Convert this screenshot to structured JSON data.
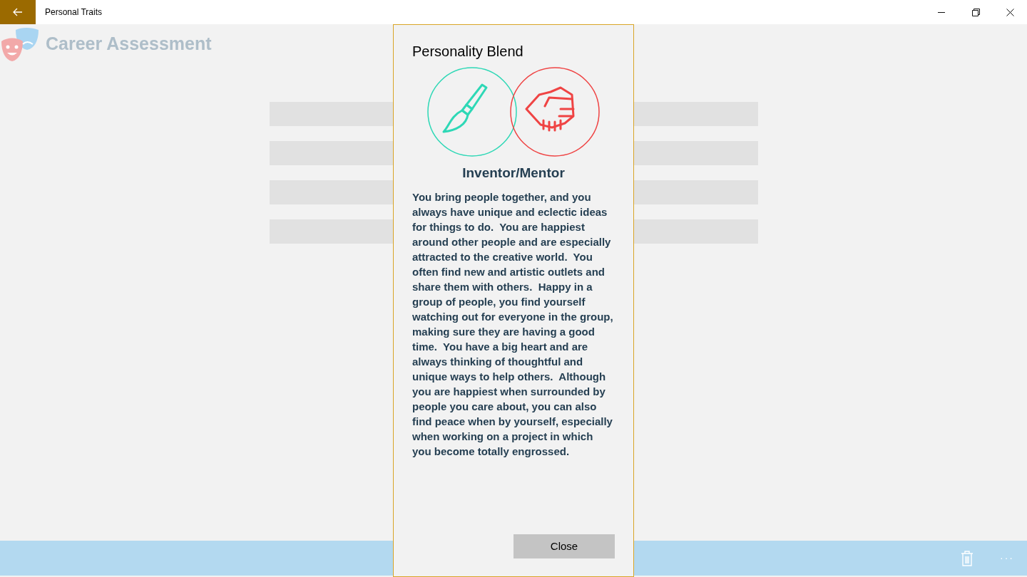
{
  "window": {
    "title": "Personal Traits"
  },
  "app": {
    "title": "Career Assessment"
  },
  "list": {
    "rows": [
      {
        "kind": "placeholder"
      },
      {
        "kind": "placeholder"
      },
      {
        "kind": "placeholder"
      },
      {
        "kind": "placeholder"
      }
    ]
  },
  "dialog": {
    "title": "Personality Blend",
    "blend_name": "Inventor/Mentor",
    "description": "You bring people together, and you always have unique and eclectic ideas for things to do.  You are happiest around other people and are especially attracted to the creative world.  You often find new and artistic outlets and share them with others.  Happy in a group of people, you find yourself watching out for everyone in the group, making sure they are having a good time.  You have a big heart and are always thinking of thoughtful and unique ways to help others.  Although you are happiest when surrounded by people you care about, you can also find peace when by yourself, especially when working on a project in which you become totally engrossed.",
    "traits": [
      {
        "kind": "brush",
        "color": "#2ed8b6"
      },
      {
        "kind": "handshake",
        "color": "#ef4444"
      }
    ],
    "close_button": "Close"
  },
  "app_bar": {
    "more": "···"
  }
}
